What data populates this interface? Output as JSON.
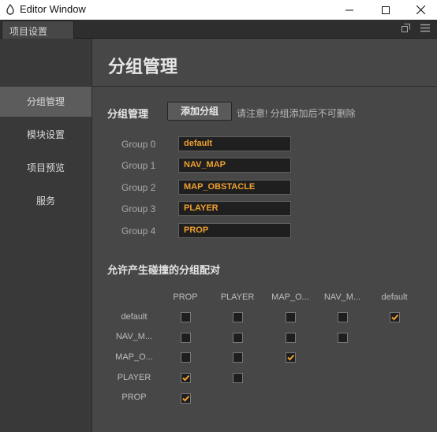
{
  "window": {
    "title": "Editor Window",
    "tab_label": "项目设置"
  },
  "sidebar": {
    "items": [
      {
        "label": "分组管理",
        "active": true
      },
      {
        "label": "模块设置",
        "active": false
      },
      {
        "label": "项目预览",
        "active": false
      },
      {
        "label": "服务",
        "active": false
      }
    ]
  },
  "main": {
    "title": "分组管理",
    "groups_section": {
      "title": "分组管理",
      "add_button": "添加分组",
      "hint": "请注意! 分组添加后不可删除",
      "groups": [
        {
          "label": "Group 0",
          "value": "default"
        },
        {
          "label": "Group 1",
          "value": "NAV_MAP"
        },
        {
          "label": "Group 2",
          "value": "MAP_OBSTACLE"
        },
        {
          "label": "Group 3",
          "value": "PLAYER"
        },
        {
          "label": "Group 4",
          "value": "PROP"
        }
      ]
    },
    "collision_section": {
      "title": "允许产生碰撞的分组配对",
      "columns": [
        "PROP",
        "PLAYER",
        "MAP_O...",
        "NAV_M...",
        "default"
      ],
      "rows": [
        {
          "label": "default",
          "checks": [
            false,
            false,
            false,
            false,
            true
          ]
        },
        {
          "label": "NAV_M...",
          "checks": [
            false,
            false,
            false,
            false
          ]
        },
        {
          "label": "MAP_O...",
          "checks": [
            false,
            false,
            true
          ]
        },
        {
          "label": "PLAYER",
          "checks": [
            true,
            false
          ]
        },
        {
          "label": "PROP",
          "checks": [
            true
          ]
        }
      ]
    }
  },
  "colors": {
    "accent": "#f0a030",
    "panel_bg": "#474747",
    "sidebar_bg": "#393939",
    "field_bg": "#1f1f1f"
  },
  "icons": [
    "app-drop-icon",
    "minimize-icon",
    "maximize-icon",
    "close-icon",
    "popout-icon",
    "menu-icon",
    "checkmark-icon"
  ]
}
